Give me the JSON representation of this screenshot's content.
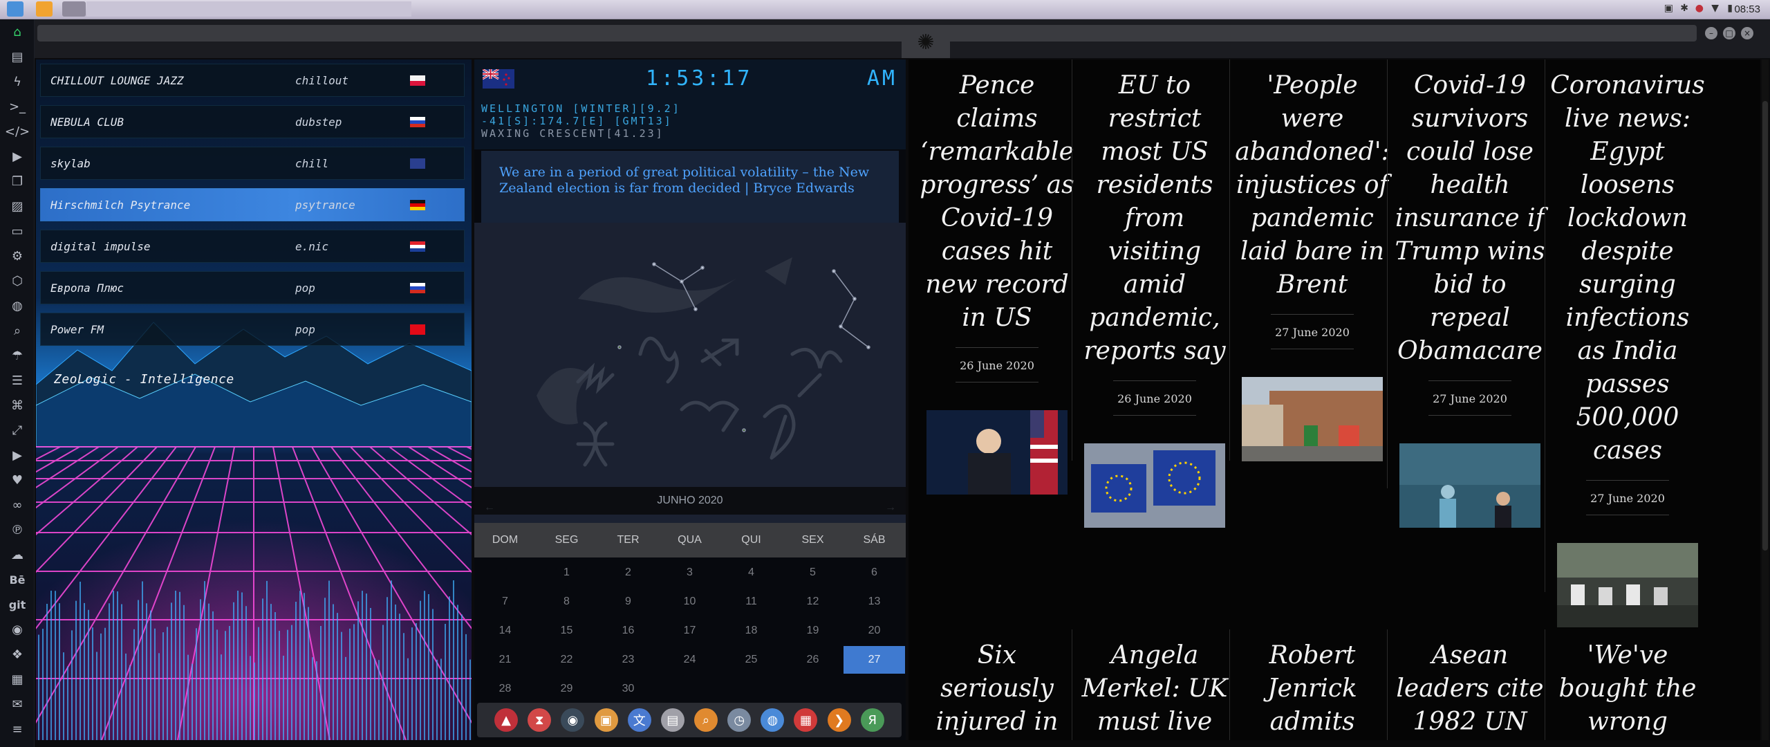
{
  "system": {
    "clock": "08:53"
  },
  "left_dock": {
    "items": [
      {
        "icon": "home-icon",
        "active": true
      },
      {
        "icon": "document-icon"
      },
      {
        "icon": "lightning-icon"
      },
      {
        "icon": "terminal-icon"
      },
      {
        "icon": "code-icon"
      },
      {
        "icon": "play-icon"
      },
      {
        "icon": "copy-icon"
      },
      {
        "icon": "image-icon"
      },
      {
        "icon": "id-card-icon"
      },
      {
        "icon": "gear-icon"
      },
      {
        "icon": "package-icon"
      },
      {
        "icon": "globe-icon"
      },
      {
        "icon": "search-icon"
      },
      {
        "icon": "umbrella-icon"
      },
      {
        "icon": "contact-icon"
      },
      {
        "icon": "tag-icon"
      },
      {
        "icon": "expand-icon"
      },
      {
        "icon": "youtube-icon"
      },
      {
        "icon": "heart-icon"
      },
      {
        "icon": "infinity-icon"
      },
      {
        "icon": "pinterest-icon"
      },
      {
        "icon": "cloud-icon"
      },
      {
        "icon": "behance-icon",
        "text": "Bē"
      },
      {
        "icon": "git-icon",
        "text": "git"
      },
      {
        "icon": "github-icon"
      },
      {
        "icon": "cubes-icon"
      },
      {
        "icon": "map-icon"
      },
      {
        "icon": "mail-icon"
      },
      {
        "icon": "stack-icon"
      }
    ]
  },
  "radio": {
    "stations": [
      {
        "name": "CHILLOUT LOUNGE JAZZ",
        "genre": "chillout",
        "flag": "poland"
      },
      {
        "name": "NEBULA CLUB",
        "genre": "dubstep",
        "flag": "russia"
      },
      {
        "name": "skylab",
        "genre": "chill",
        "flag": "uk"
      },
      {
        "name": "Hirschmilch Psytrance",
        "genre": "psytrance",
        "flag": "germany",
        "selected": true
      },
      {
        "name": "digital impulse",
        "genre": "e.nic",
        "flag": "croatia"
      },
      {
        "name": "Европа Плюс",
        "genre": "pop",
        "flag": "russia"
      },
      {
        "name": "Power FM",
        "genre": "pop",
        "flag": "turkey"
      }
    ],
    "now_playing": "ZeoLogic - Intelligence"
  },
  "clock_widget": {
    "time": "1:53:17",
    "ampm": "AM",
    "location": "WELLINGTON [WINTER][9.2]",
    "coords": "-41[S]:174.7[E] [GMT13]",
    "moon": "WAXING CRESCENT[41.23]",
    "quote": "We are in a period of great political volatility – the New Zealand election is far from decided | Bryce Edwards"
  },
  "calendar": {
    "month_label": "JUNHO 2020",
    "prev": "←",
    "next": "→",
    "day_names": [
      "DOM",
      "SEG",
      "TER",
      "QUA",
      "QUI",
      "SEX",
      "SÁB"
    ],
    "weeks": [
      [
        "",
        "1",
        "2",
        "3",
        "4",
        "5",
        "6"
      ],
      [
        "7",
        "8",
        "9",
        "10",
        "11",
        "12",
        "13"
      ],
      [
        "14",
        "15",
        "16",
        "17",
        "18",
        "19",
        "20"
      ],
      [
        "21",
        "22",
        "23",
        "24",
        "25",
        "26",
        "27"
      ],
      [
        "28",
        "29",
        "30",
        "",
        "",
        "",
        ""
      ]
    ],
    "today": "27"
  },
  "dock": {
    "items": [
      {
        "icon": "arch-icon",
        "color": "#c0303a"
      },
      {
        "icon": "hourglass-icon",
        "color": "#d24848"
      },
      {
        "icon": "earth-icon",
        "color": "#3a4a5a"
      },
      {
        "icon": "photos-icon",
        "color": "#e09a40"
      },
      {
        "icon": "translate-icon",
        "color": "#4a7ad0"
      },
      {
        "icon": "news-icon",
        "color": "#a0a0a8"
      },
      {
        "icon": "magnifier-icon",
        "color": "#e08a30"
      },
      {
        "icon": "clock-icon",
        "color": "#7a8aa0"
      },
      {
        "icon": "browser-icon",
        "color": "#4a8ad8"
      },
      {
        "icon": "calendar-icon",
        "color": "#d03a3a"
      },
      {
        "icon": "arrow-icon",
        "color": "#e07a20"
      },
      {
        "icon": "yandex-icon",
        "color": "#4a9a58"
      }
    ]
  },
  "news": {
    "top": [
      {
        "headline": "Pence claims ‘remarkable progress’ as Covid-19 cases hit new record in US",
        "date": "26 June 2020",
        "image": "pence-podium"
      },
      {
        "headline": "EU to restrict most US residents from visiting amid pandemic, reports say",
        "date": "26 June 2020",
        "image": "eu-flags"
      },
      {
        "headline": "'People were abandoned': injustices of pandemic laid bare in Brent",
        "date": "27 June 2020",
        "image": "brent-street"
      },
      {
        "headline": "Covid-19 survivors could lose health insurance if Trump wins bid to repeal Obamacare",
        "date": "27 June 2020",
        "image": "nyu-langone"
      },
      {
        "headline": "Coronavirus live news: Egypt loosens lockdown despite surging infections as India passes 500,000 cases",
        "date": "27 June 2020",
        "image": "mosque-prayer"
      }
    ],
    "bottom": [
      {
        "headline": "Six seriously injured in Glasgow"
      },
      {
        "headline": "Angela Merkel: UK must live"
      },
      {
        "headline": "Robert Jenrick admits"
      },
      {
        "headline": "Asean leaders cite 1982 UN"
      },
      {
        "headline": "'We've bought the wrong"
      }
    ]
  }
}
